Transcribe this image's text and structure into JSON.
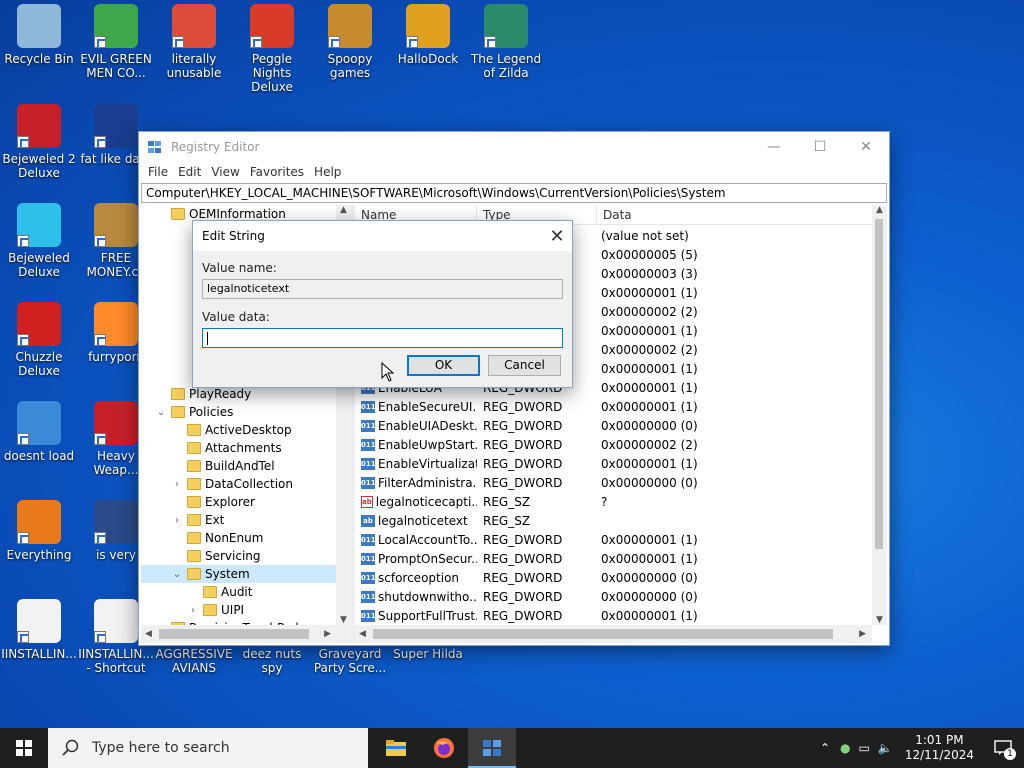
{
  "desktop": {
    "icons": [
      {
        "label": "Recycle Bin"
      },
      {
        "label": "EVIL GREEN MEN CO..."
      },
      {
        "label": "literally unusable"
      },
      {
        "label": "Peggle Nights Deluxe"
      },
      {
        "label": "Spoopy games"
      },
      {
        "label": "HalloDock"
      },
      {
        "label": "The Legend of Zilda"
      },
      {
        "label": "Bejeweled 2 Deluxe"
      },
      {
        "label": "fat like dark"
      },
      {
        "label": "Bejeweled Deluxe"
      },
      {
        "label": "FREE MONEY.co"
      },
      {
        "label": "Chuzzle Deluxe"
      },
      {
        "label": "furryporn"
      },
      {
        "label": "doesnt load"
      },
      {
        "label": "Heavy Weap..."
      },
      {
        "label": "Everything"
      },
      {
        "label": "is very"
      },
      {
        "label": "IINSTALLIN..."
      },
      {
        "label": "IINSTALLIN... - Shortcut"
      },
      {
        "label": "AGGRESSIVE AVIANS"
      },
      {
        "label": "deez nuts spy"
      },
      {
        "label": "Graveyard Party Scre..."
      },
      {
        "label": "Super Hilda"
      }
    ]
  },
  "window": {
    "title": "Registry Editor",
    "menu": [
      "File",
      "Edit",
      "View",
      "Favorites",
      "Help"
    ],
    "address": "Computer\\HKEY_LOCAL_MACHINE\\SOFTWARE\\Microsoft\\Windows\\CurrentVersion\\Policies\\System",
    "tree": [
      {
        "label": "OEMInformation",
        "indent": 1,
        "exp": ""
      },
      {
        "label": "PlayReady",
        "indent": 1,
        "exp": ""
      },
      {
        "label": "Policies",
        "indent": 1,
        "exp": "⌄"
      },
      {
        "label": "ActiveDesktop",
        "indent": 2,
        "exp": ""
      },
      {
        "label": "Attachments",
        "indent": 2,
        "exp": ""
      },
      {
        "label": "BuildAndTel",
        "indent": 2,
        "exp": ""
      },
      {
        "label": "DataCollection",
        "indent": 2,
        "exp": "›"
      },
      {
        "label": "Explorer",
        "indent": 2,
        "exp": ""
      },
      {
        "label": "Ext",
        "indent": 2,
        "exp": "›"
      },
      {
        "label": "NonEnum",
        "indent": 2,
        "exp": ""
      },
      {
        "label": "Servicing",
        "indent": 2,
        "exp": ""
      },
      {
        "label": "System",
        "indent": 2,
        "exp": "⌄"
      },
      {
        "label": "Audit",
        "indent": 3,
        "exp": ""
      },
      {
        "label": "UIPI",
        "indent": 3,
        "exp": "›"
      },
      {
        "label": "PrecisionTouchPad",
        "indent": 1,
        "exp": ""
      }
    ],
    "columns": {
      "name": "Name",
      "type": "Type",
      "data": "Data"
    },
    "values": [
      {
        "name": "",
        "type": "",
        "data": "(value not set)",
        "icon": ""
      },
      {
        "name": "",
        "type": "",
        "data": "0x00000005 (5)",
        "icon": ""
      },
      {
        "name": "",
        "type": "",
        "data": "0x00000003 (3)",
        "icon": ""
      },
      {
        "name": "",
        "type": "",
        "data": "0x00000001 (1)",
        "icon": ""
      },
      {
        "name": "",
        "type": "",
        "data": "0x00000002 (2)",
        "icon": ""
      },
      {
        "name": "",
        "type": "",
        "data": "0x00000001 (1)",
        "icon": ""
      },
      {
        "name": "",
        "type": "",
        "data": "0x00000002 (2)",
        "icon": ""
      },
      {
        "name": "",
        "type": "",
        "data": "0x00000001 (1)",
        "icon": ""
      },
      {
        "name": "EnableLUA",
        "type": "REG_DWORD",
        "data": "0x00000001 (1)",
        "icon": "dw"
      },
      {
        "name": "EnableSecureUI...",
        "type": "REG_DWORD",
        "data": "0x00000001 (1)",
        "icon": "dw"
      },
      {
        "name": "EnableUIADeskt...",
        "type": "REG_DWORD",
        "data": "0x00000000 (0)",
        "icon": "dw"
      },
      {
        "name": "EnableUwpStart...",
        "type": "REG_DWORD",
        "data": "0x00000002 (2)",
        "icon": "dw"
      },
      {
        "name": "EnableVirtualizat...",
        "type": "REG_DWORD",
        "data": "0x00000001 (1)",
        "icon": "dw"
      },
      {
        "name": "FilterAdministra...",
        "type": "REG_DWORD",
        "data": "0x00000000 (0)",
        "icon": "dw"
      },
      {
        "name": "legalnoticecapti...",
        "type": "REG_SZ",
        "data": "?",
        "icon": "sz"
      },
      {
        "name": "legalnoticetext",
        "type": "REG_SZ",
        "data": "",
        "icon": "sz2"
      },
      {
        "name": "LocalAccountTo...",
        "type": "REG_DWORD",
        "data": "0x00000001 (1)",
        "icon": "dw"
      },
      {
        "name": "PromptOnSecur...",
        "type": "REG_DWORD",
        "data": "0x00000001 (1)",
        "icon": "dw"
      },
      {
        "name": "scforceoption",
        "type": "REG_DWORD",
        "data": "0x00000000 (0)",
        "icon": "dw"
      },
      {
        "name": "shutdownwitho...",
        "type": "REG_DWORD",
        "data": "0x00000000 (0)",
        "icon": "dw"
      },
      {
        "name": "SupportFullTrust...",
        "type": "REG_DWORD",
        "data": "0x00000001 (1)",
        "icon": "dw"
      }
    ]
  },
  "dialog": {
    "title": "Edit String",
    "value_name_label": "Value name:",
    "value_name": "legalnoticetext",
    "value_data_label": "Value data:",
    "value_data": "",
    "ok": "OK",
    "cancel": "Cancel"
  },
  "taskbar": {
    "search_placeholder": "Type here to search",
    "time": "1:01 PM",
    "date": "12/11/2024",
    "notifications": "1"
  }
}
